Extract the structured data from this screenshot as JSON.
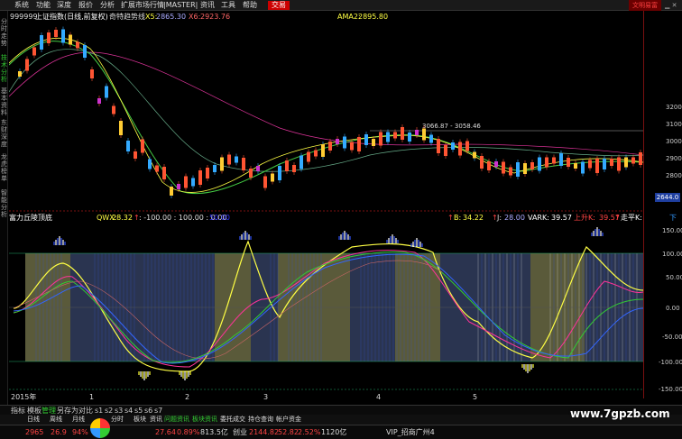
{
  "menu": {
    "items": [
      "系统",
      "功能",
      "深度",
      "报价",
      "分析",
      "扩展市场行情",
      "|MASTER|",
      "资讯",
      "工具",
      "帮助"
    ],
    "trade_button": "交易",
    "brand": "文明易富"
  },
  "side_tabs": [
    "分时走势",
    "技术分析",
    "基本资料",
    "东财深度",
    "龙虎榜单",
    "智能分析"
  ],
  "header": {
    "code": "999999",
    "name": "上证指数(日线,前复权)",
    "indicator": "奇特趋势线",
    "x5_label": "X5:",
    "x5_value": "2865.30",
    "x6_label": "X6:",
    "x6_value": "2923.76",
    "ama2_label": "AMA2:",
    "ama2_value": "2895.80"
  },
  "price_axis": {
    "ticks": [
      "3200",
      "3100",
      "3000",
      "2900",
      "2800"
    ],
    "current": "2644.0",
    "annotation": "3066.87 - 3058.46"
  },
  "indicator_header": {
    "name": "富力丘陵顶底",
    "qwx_label": "QWX:",
    "qwx_value": "28.32",
    "arrow": "↑",
    "fixed_values": ": -100.00 : 100.00 : 0.00",
    "tail_value": "50.00",
    "b_label": "B:",
    "b_value": "34.22",
    "j_label": "J:",
    "j_value": "28.00",
    "vark_label": "VARK:",
    "vark_value": "39.57",
    "up_label": "上升K:",
    "up_value": "39.57",
    "flat_label": "走平K:",
    "down_label": "下"
  },
  "indicator_axis": {
    "ticks": [
      "150.00",
      "100.00",
      "50.00",
      "0.00",
      "-50.00",
      "-100.00",
      "-150.00"
    ]
  },
  "time_axis": {
    "year": "2015年",
    "months": [
      "1",
      "2",
      "3",
      "4",
      "5"
    ]
  },
  "toolbar": {
    "items": [
      "指标",
      "模板",
      "管理",
      "另存为",
      "对比",
      "s1",
      "s2",
      "s3",
      "s4",
      "s5",
      "s6",
      "s7"
    ],
    "active": "管理"
  },
  "ticker_tabs": [
    "日线",
    "周线",
    "月线",
    "分时",
    "板块",
    "资讯",
    "问题资讯",
    "板块资讯",
    "委托成交",
    "持仓查询",
    "帐户资金"
  ],
  "status": {
    "s1": "2965",
    "s2": "26.9",
    "s3": "94%",
    "s4": "27.64",
    "s5": "0.89%",
    "s6": "813.5亿",
    "s7": "创业",
    "s8": "2144.82",
    "s9": "52.82",
    "s10": "2.52%",
    "s11": "1120亿",
    "s12": "VIP_招商广州4"
  },
  "watermark": "www.7gpzb.com",
  "colors": {
    "up": "#ff3333",
    "down": "#33aaff",
    "active": "#33cc33",
    "panel_yellow": "#5a5a3a",
    "panel_blue": "#2a3450"
  }
}
